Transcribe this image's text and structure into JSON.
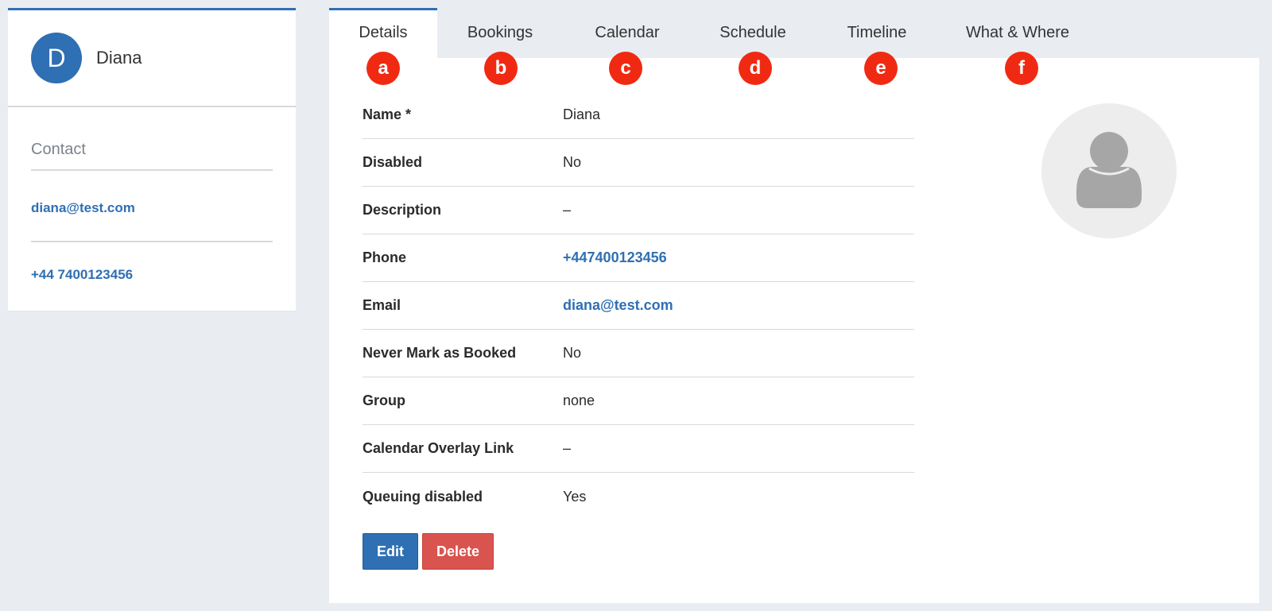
{
  "profile": {
    "initial": "D",
    "name": "Diana",
    "contact_heading": "Contact",
    "email": "diana@test.com",
    "phone": "+44 7400123456"
  },
  "tabs": [
    {
      "label": "Details",
      "badge": "a",
      "active": true
    },
    {
      "label": "Bookings",
      "badge": "b",
      "active": false
    },
    {
      "label": "Calendar",
      "badge": "c",
      "active": false
    },
    {
      "label": "Schedule",
      "badge": "d",
      "active": false
    },
    {
      "label": "Timeline",
      "badge": "e",
      "active": false
    },
    {
      "label": "What & Where",
      "badge": "f",
      "active": false
    }
  ],
  "details": [
    {
      "label": "Name *",
      "value": "Diana"
    },
    {
      "label": "Disabled",
      "value": "No"
    },
    {
      "label": "Description",
      "value": "–"
    },
    {
      "label": "Phone",
      "value": "+447400123456"
    },
    {
      "label": "Email",
      "value": "diana@test.com"
    },
    {
      "label": "Never Mark as Booked",
      "value": "No"
    },
    {
      "label": "Group",
      "value": "none"
    },
    {
      "label": "Calendar Overlay Link",
      "value": "–"
    },
    {
      "label": "Queuing disabled",
      "value": "Yes"
    }
  ],
  "actions": {
    "edit_label": "Edit",
    "delete_label": "Delete"
  },
  "colors": {
    "accent": "#2f6fb3",
    "danger": "#d9534f",
    "badge": "#f02a12",
    "background": "#e9edf2"
  },
  "icons": {
    "photo_placeholder": "user-silhouette-icon"
  }
}
